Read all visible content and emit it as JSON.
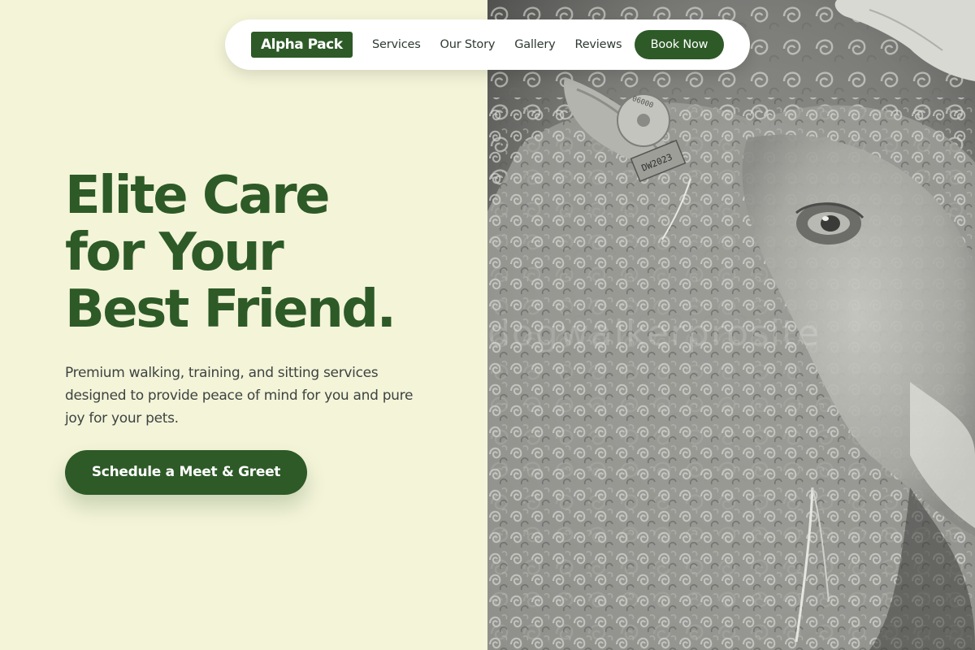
{
  "brand": {
    "logo_text": "Alpha Pack",
    "color": "#2d5a27",
    "background": "#f4f4d9"
  },
  "nav": {
    "links": [
      "Services",
      "Our Story",
      "Gallery",
      "Reviews"
    ],
    "book_label": "Book Now"
  },
  "hero": {
    "title_lines": [
      "Elite Care",
      "for Your",
      "Best Friend."
    ],
    "subtitle": "Premium walking, training, and sitting services designed to provide peace of mind for you and pure joy for your pets.",
    "cta_label": "Schedule a Meet & Greet"
  },
  "photo": {
    "subject": "close-up black and white sheep face with curly wool",
    "tag_text": "DW2023",
    "watermark": "dogwalkerprosite"
  }
}
